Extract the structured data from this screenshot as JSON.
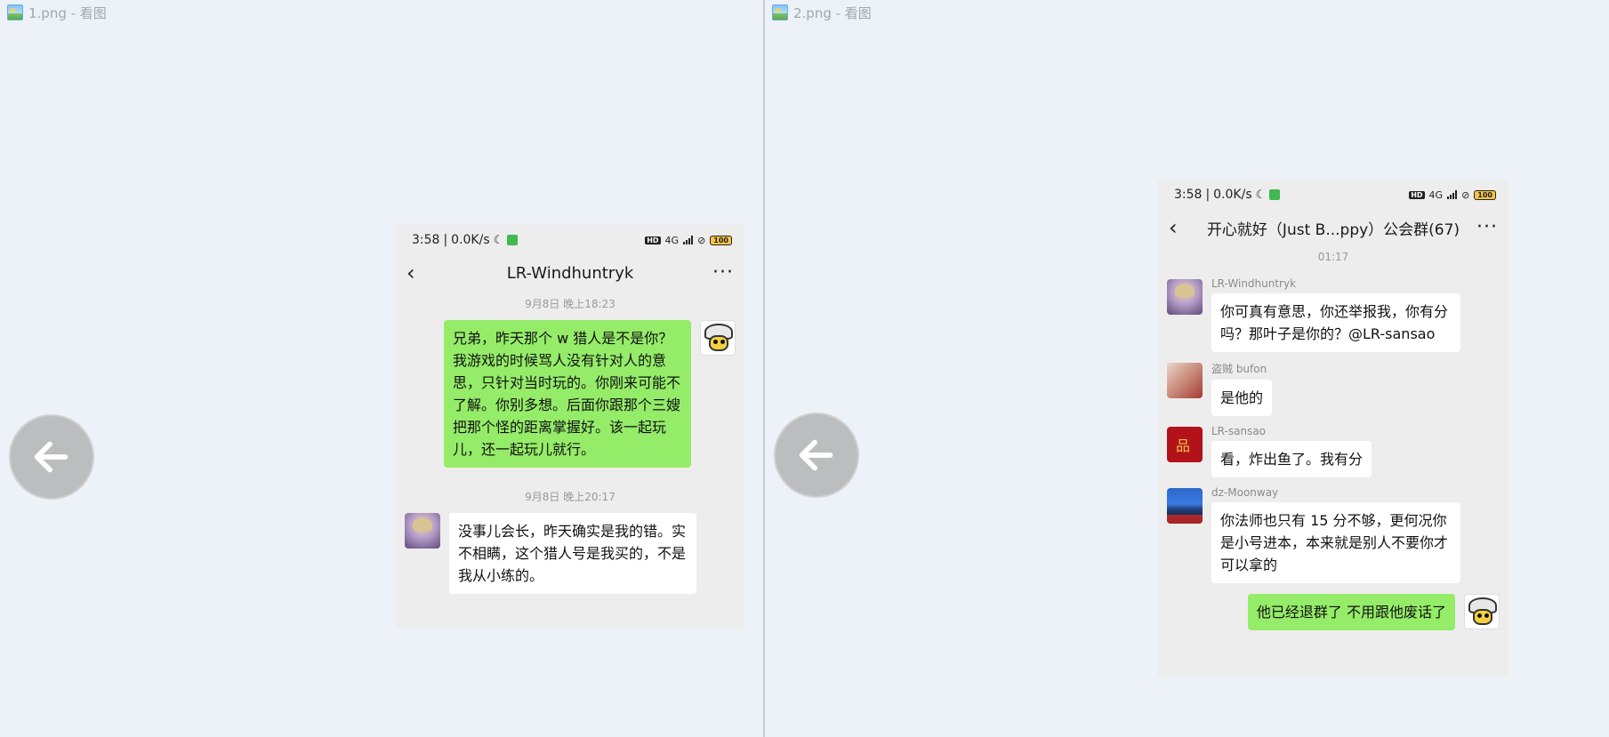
{
  "left_window": {
    "title": "1.png - 看图",
    "phone": {
      "status": {
        "time": "3:58",
        "speed": "0.0K/s",
        "network": "4G",
        "battery": "100"
      },
      "header": {
        "title": "LR-Windhuntryk"
      },
      "messages": [
        {
          "type": "time",
          "text": "9月8日 晚上18:23"
        },
        {
          "type": "out",
          "text": "兄弟，昨天那个 w 猎人是不是你？我游戏的时候骂人没有针对人的意思，只针对当时玩的。你刚来可能不了解。你别多想。后面你跟那个三嫂把那个怪的距离掌握好。该一起玩儿，还一起玩儿就行。"
        },
        {
          "type": "time",
          "text": "9月8日 晚上20:17"
        },
        {
          "type": "in",
          "text": "没事儿会长，昨天确实是我的错。实不相瞒，这个猎人号是我买的，不是我从小练的。"
        }
      ]
    }
  },
  "right_window": {
    "title": "2.png - 看图",
    "phone": {
      "status": {
        "time": "3:58",
        "speed": "0.0K/s",
        "network": "4G",
        "battery": "100"
      },
      "header": {
        "title": "开心就好（Just B...ppy）公会群(67)"
      },
      "messages": [
        {
          "type": "time",
          "text": "01:17"
        },
        {
          "type": "in",
          "sender": "LR-Windhuntryk",
          "text": "你可真有意思，你还举报我，你有分吗？那叶子是你的？@LR-sansao"
        },
        {
          "type": "in",
          "sender": "盗贼 bufon",
          "text": "是他的"
        },
        {
          "type": "in",
          "sender": "LR-sansao",
          "text": "看，炸出鱼了。我有分"
        },
        {
          "type": "in",
          "sender": "dz-Moonway",
          "text": "你法师也只有 15 分不够，更何况你是小号进本，本来就是别人不要你才可以拿的"
        },
        {
          "type": "out",
          "text": "他已经退群了 不用跟他废话了"
        }
      ]
    }
  }
}
